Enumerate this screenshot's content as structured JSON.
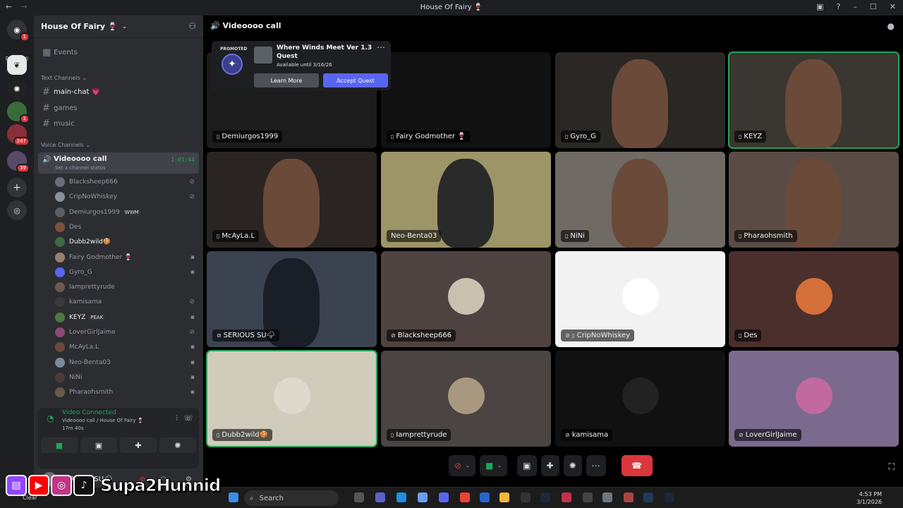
{
  "window": {
    "title": "House Of Fairy 🍷"
  },
  "servers": {
    "read_all": "Read All",
    "badges": [
      "1",
      "1",
      "247",
      "39"
    ]
  },
  "guild": {
    "name": "House Of Fairy 🍷"
  },
  "channels": {
    "events": "Events",
    "text_category": "Text Channels",
    "text": [
      "main-chat 💗",
      "games",
      "music"
    ],
    "voice_category": "Voice Channels",
    "voice": {
      "name": "Videoooo call",
      "status": "Set a channel status",
      "timer": "1:01:44"
    },
    "users": [
      {
        "name": "Blacksheep666",
        "tag": "",
        "bright": false
      },
      {
        "name": "CripNoWhiskey",
        "tag": "",
        "bright": false
      },
      {
        "name": "Demiurgos1999",
        "tag": "WWM",
        "bright": false
      },
      {
        "name": "Des",
        "tag": "",
        "bright": false
      },
      {
        "name": "Dubb2wild🍪",
        "tag": "",
        "bright": true
      },
      {
        "name": "Fairy Godmother 🍷",
        "tag": "",
        "bright": false
      },
      {
        "name": "Gyro_G",
        "tag": "",
        "bright": false
      },
      {
        "name": "Iamprettyrude",
        "tag": "",
        "bright": false
      },
      {
        "name": "kamisama",
        "tag": "",
        "bright": false
      },
      {
        "name": "KEYZ",
        "tag": "PEAK",
        "bright": true
      },
      {
        "name": "LoverGirlJaime",
        "tag": "",
        "bright": false
      },
      {
        "name": "McAyLa.L",
        "tag": "",
        "bright": false
      },
      {
        "name": "Neo-Benta03",
        "tag": "",
        "bright": false
      },
      {
        "name": "NiNi",
        "tag": "",
        "bright": false
      },
      {
        "name": "Pharaohsmith",
        "tag": "",
        "bright": false
      }
    ]
  },
  "voice_panel": {
    "status": "Video Connected",
    "location": "Videoooo call / House Of Fairy 🍷",
    "elapsed": "17m 40s"
  },
  "user": {
    "name": "SERIOUS SU🌩"
  },
  "main": {
    "header": "Videoooo call",
    "promo": {
      "label": "PROMOTED",
      "title": "Where Winds Meet Ver 1.3 Quest",
      "available": "Available until 3/16/26",
      "learn_more": "Learn More",
      "accept": "Accept Quest"
    },
    "tiles": [
      {
        "name": "Demiurgos1999",
        "icon": "▯",
        "bg": "#1c1c1c"
      },
      {
        "name": "Fairy Godmother 🍷",
        "icon": "▯",
        "bg": "#111111"
      },
      {
        "name": "Gyro_G",
        "icon": "▯",
        "bg": "#2a2724"
      },
      {
        "name": "KEYZ",
        "icon": "▯",
        "bg": "#3a3631"
      },
      {
        "name": "McAyLa.L",
        "icon": "▯",
        "bg": "#2a2522"
      },
      {
        "name": "Neo-Benta03",
        "icon": "",
        "bg": "#9c9567"
      },
      {
        "name": "NiNi",
        "icon": "▯",
        "bg": "#6f6a63"
      },
      {
        "name": "Pharaohsmith",
        "icon": "▯",
        "bg": "#5a4c45"
      },
      {
        "name": "SERIOUS SU🌩",
        "icon": "⊘",
        "bg": "#3b4250"
      },
      {
        "name": "Blacksheep666",
        "icon": "⊘",
        "bg": "#4e4340"
      },
      {
        "name": "CripNoWhiskey",
        "icon": "⊘ ▯",
        "bg": "#f2f2f2"
      },
      {
        "name": "Des",
        "icon": "▯",
        "bg": "#4a2f2d"
      },
      {
        "name": "Dubb2wild🍪",
        "icon": "▯",
        "bg": "#cfccbc"
      },
      {
        "name": "Iamprettyrude",
        "icon": "▯",
        "bg": "#4a4542"
      },
      {
        "name": "kamisama",
        "icon": "⊘",
        "bg": "#111111"
      },
      {
        "name": "LoverGirlJaime",
        "icon": "⊘",
        "bg": "#7b6a8e"
      }
    ]
  },
  "taskbar": {
    "search": "Search",
    "weather": "Clear",
    "time": "4:53 PM",
    "date": "3/1/2026"
  },
  "overlay": {
    "brand": "Supa2Hunnid"
  }
}
